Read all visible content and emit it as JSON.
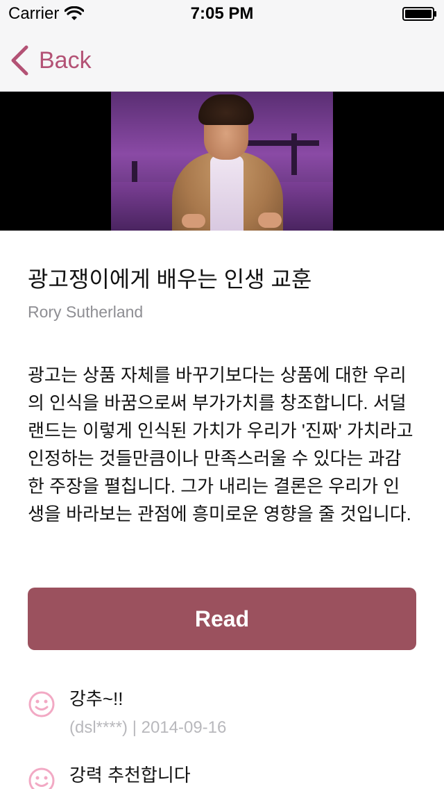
{
  "status_bar": {
    "carrier": "Carrier",
    "time": "7:05 PM"
  },
  "nav": {
    "back_label": "Back",
    "accent_color": "#b35275"
  },
  "video": {
    "thumbnail_icon": "video-thumbnail"
  },
  "talk": {
    "title": "광고쟁이에게 배우는 인생 교훈",
    "speaker": "Rory Sutherland",
    "description": "광고는 상품 자체를 바꾸기보다는 상품에 대한 우리의 인식을 바꿈으로써 부가가치를 창조합니다. 서덜랜드는 이렇게 인식된 가치가 우리가 '진짜' 가치라고 인정하는 것들만큼이나 만족스러울 수 있다는 과감한 주장을 펼칩니다. 그가 내리는 결론은 우리가 인생을 바라보는 관점에 흥미로운 영향을 줄 것입니다."
  },
  "read_button": {
    "label": "Read",
    "color": "#9b515e"
  },
  "comments": [
    {
      "text": "강추~!!",
      "meta": "(dsl****) | 2014-09-16",
      "icon": "smiley-icon"
    },
    {
      "text": "강력 추천합니다",
      "meta": "",
      "icon": "smiley-icon"
    }
  ]
}
